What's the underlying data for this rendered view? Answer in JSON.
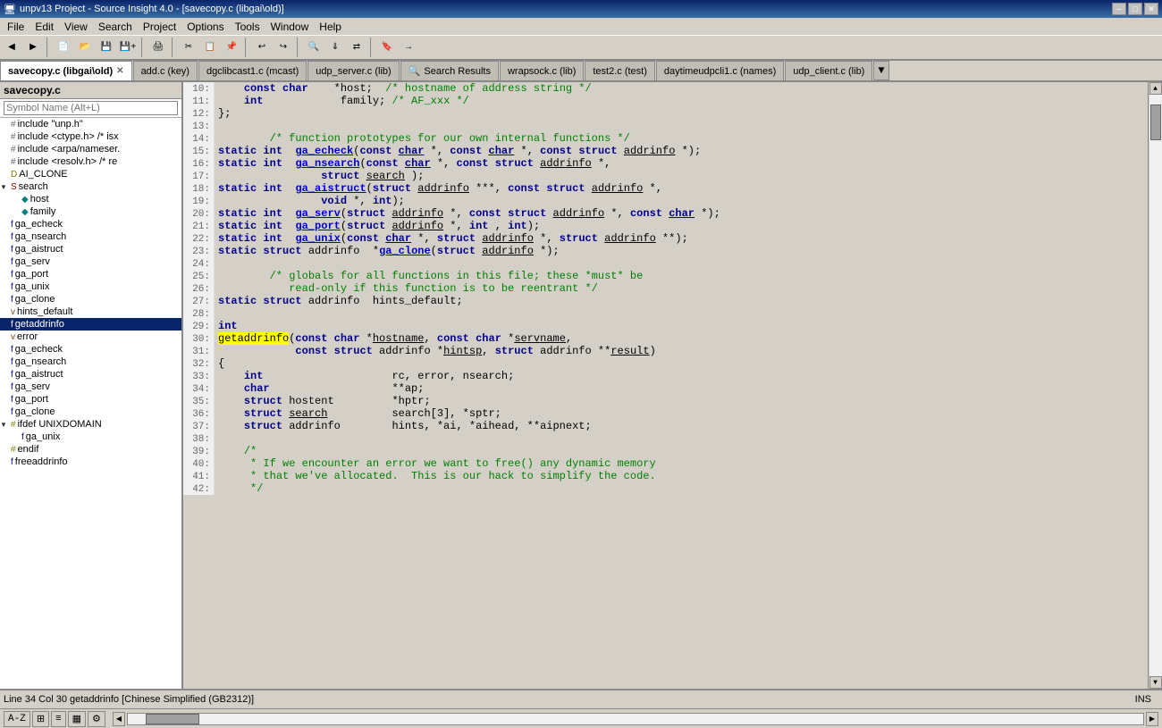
{
  "window": {
    "title": "unpv13 Project - Source Insight 4.0 - [savecopy.c (libgai\\old)]",
    "icon": "source-insight-icon"
  },
  "menus": [
    "File",
    "Edit",
    "View",
    "Search",
    "Project",
    "Options",
    "Tools",
    "Window",
    "Help"
  ],
  "tabs": [
    {
      "label": "savecopy.c (libgai\\old)",
      "active": true,
      "closeable": true
    },
    {
      "label": "add.c (key)",
      "active": false,
      "closeable": false
    },
    {
      "label": "dgclibcast1.c (mcast)",
      "active": false,
      "closeable": false
    },
    {
      "label": "udp_server.c (lib)",
      "active": false,
      "closeable": false
    },
    {
      "label": "Search Results",
      "active": false,
      "closeable": false,
      "icon": "search"
    },
    {
      "label": "wrapsock.c (lib)",
      "active": false,
      "closeable": false
    },
    {
      "label": "test2.c (test)",
      "active": false,
      "closeable": false
    },
    {
      "label": "daytimeudpcli1.c (names)",
      "active": false,
      "closeable": false
    },
    {
      "label": "udp_client.c (lib)",
      "active": false,
      "closeable": false
    }
  ],
  "sidebar": {
    "title": "savecopy.c",
    "search_placeholder": "Symbol Name (Alt+L)",
    "tree": [
      {
        "id": "include_unp",
        "label": "include \"unp.h\"",
        "level": 0,
        "icon": "hash",
        "expanded": false
      },
      {
        "id": "include_ctype",
        "label": "include <ctype.h> /* isx",
        "level": 0,
        "icon": "hash",
        "expanded": false
      },
      {
        "id": "include_arpa",
        "label": "include <arpa/nameser.",
        "level": 0,
        "icon": "hash",
        "expanded": false
      },
      {
        "id": "include_resolv",
        "label": "include <resolv.h> /* re",
        "level": 0,
        "icon": "hash",
        "expanded": false
      },
      {
        "id": "ai_clone",
        "label": "AI_CLONE",
        "level": 0,
        "icon": "define",
        "expanded": false
      },
      {
        "id": "search_struct",
        "label": "search",
        "level": 0,
        "icon": "struct",
        "expanded": true
      },
      {
        "id": "host",
        "label": "host",
        "level": 1,
        "icon": "field"
      },
      {
        "id": "family",
        "label": "family",
        "level": 1,
        "icon": "field"
      },
      {
        "id": "ga_echeck1",
        "label": "ga_echeck",
        "level": 0,
        "icon": "func"
      },
      {
        "id": "ga_nsearch1",
        "label": "ga_nsearch",
        "level": 0,
        "icon": "func"
      },
      {
        "id": "ga_aistruct1",
        "label": "ga_aistruct",
        "level": 0,
        "icon": "func"
      },
      {
        "id": "ga_serv1",
        "label": "ga_serv",
        "level": 0,
        "icon": "func"
      },
      {
        "id": "ga_port1",
        "label": "ga_port",
        "level": 0,
        "icon": "func"
      },
      {
        "id": "ga_unix1",
        "label": "ga_unix",
        "level": 0,
        "icon": "func"
      },
      {
        "id": "ga_clone1",
        "label": "ga_clone",
        "level": 0,
        "icon": "func"
      },
      {
        "id": "hints_default",
        "label": "hints_default",
        "level": 0,
        "icon": "var"
      },
      {
        "id": "getaddrinfo",
        "label": "getaddrinfo",
        "level": 0,
        "icon": "func",
        "selected": true
      },
      {
        "id": "error",
        "label": "error",
        "level": 0,
        "icon": "var"
      },
      {
        "id": "ga_echeck2",
        "label": "ga_echeck",
        "level": 0,
        "icon": "func"
      },
      {
        "id": "ga_nsearch2",
        "label": "ga_nsearch",
        "level": 0,
        "icon": "func"
      },
      {
        "id": "ga_aistruct2",
        "label": "ga_aistruct",
        "level": 0,
        "icon": "func"
      },
      {
        "id": "ga_serv2",
        "label": "ga_serv",
        "level": 0,
        "icon": "func"
      },
      {
        "id": "ga_port2",
        "label": "ga_port",
        "level": 0,
        "icon": "func"
      },
      {
        "id": "ga_clone2",
        "label": "ga_clone",
        "level": 0,
        "icon": "func"
      },
      {
        "id": "ifdef_unix",
        "label": "ifdef UNIXDOMAIN",
        "level": 0,
        "icon": "ifdef",
        "expanded": true
      },
      {
        "id": "ga_unix2",
        "label": "ga_unix",
        "level": 1,
        "icon": "func"
      },
      {
        "id": "endif",
        "label": "endif",
        "level": 0,
        "icon": "endif"
      },
      {
        "id": "freeaddrinfo",
        "label": "freeaddrinfo",
        "level": 0,
        "icon": "func"
      }
    ]
  },
  "code": {
    "lines": [
      {
        "num": 10,
        "text": "    const char    *host;  /* hostname of address string */"
      },
      {
        "num": 11,
        "text": "    int            family; /* AF_xxx */"
      },
      {
        "num": 12,
        "text": "};"
      },
      {
        "num": 13,
        "text": ""
      },
      {
        "num": 14,
        "text": "        /* function prototypes for our own internal functions */"
      },
      {
        "num": 15,
        "text": "static int  ga_echeck(const char *, const char *, const struct addrinfo *);"
      },
      {
        "num": 16,
        "text": "static int  ga_nsearch(const char *, const struct addrinfo *,"
      },
      {
        "num": 17,
        "text": "                struct search );"
      },
      {
        "num": 18,
        "text": "static int  ga_aistruct(struct addrinfo ***, const struct addrinfo *,"
      },
      {
        "num": 19,
        "text": "                void *, int);"
      },
      {
        "num": 20,
        "text": "static int  ga_serv(struct addrinfo *, const struct addrinfo *, const char *);"
      },
      {
        "num": 21,
        "text": "static int  ga_port(struct addrinfo *, int , int);"
      },
      {
        "num": 22,
        "text": "static int  ga_unix(const char *, struct addrinfo *, struct addrinfo **);"
      },
      {
        "num": 23,
        "text": "static struct addrinfo  *ga_clone(struct addrinfo *);"
      },
      {
        "num": 24,
        "text": ""
      },
      {
        "num": 25,
        "text": "        /* globals for all functions in this file; these *must* be"
      },
      {
        "num": 26,
        "text": "           read-only if this function is to be reentrant */"
      },
      {
        "num": 27,
        "text": "static struct addrinfo  hints_default;"
      },
      {
        "num": 28,
        "text": ""
      },
      {
        "num": 29,
        "text": "int"
      },
      {
        "num": 30,
        "text": "getaddrinfo(const char *hostname, const char *servname,"
      },
      {
        "num": 31,
        "text": "            const struct addrinfo *hintsp, struct addrinfo **result)"
      },
      {
        "num": 32,
        "text": "{"
      },
      {
        "num": 33,
        "text": "    int                    rc, error, nsearch;"
      },
      {
        "num": 34,
        "text": "    char                   **ap;"
      },
      {
        "num": 35,
        "text": "    struct hostent         *hptr;"
      },
      {
        "num": 36,
        "text": "    struct search          search[3], *sptr;"
      },
      {
        "num": 37,
        "text": "    struct addrinfo        hints, *ai, *aihead, **aipnext;"
      },
      {
        "num": 38,
        "text": ""
      },
      {
        "num": 39,
        "text": "    /*"
      },
      {
        "num": 40,
        "text": "     * If we encounter an error we want to free() any dynamic memory"
      },
      {
        "num": 41,
        "text": "     * that we've allocated.  This is our hack to simplify the code."
      },
      {
        "num": 42,
        "text": "     */"
      }
    ]
  },
  "status": {
    "left": "Line 34  Col 30   getaddrinfo  [Chinese Simplified (GB2312)]",
    "right": "INS"
  },
  "bottom_toolbar": {
    "az_label": "A-Z",
    "icons": [
      "grid",
      "list",
      "filter",
      "gear"
    ]
  }
}
